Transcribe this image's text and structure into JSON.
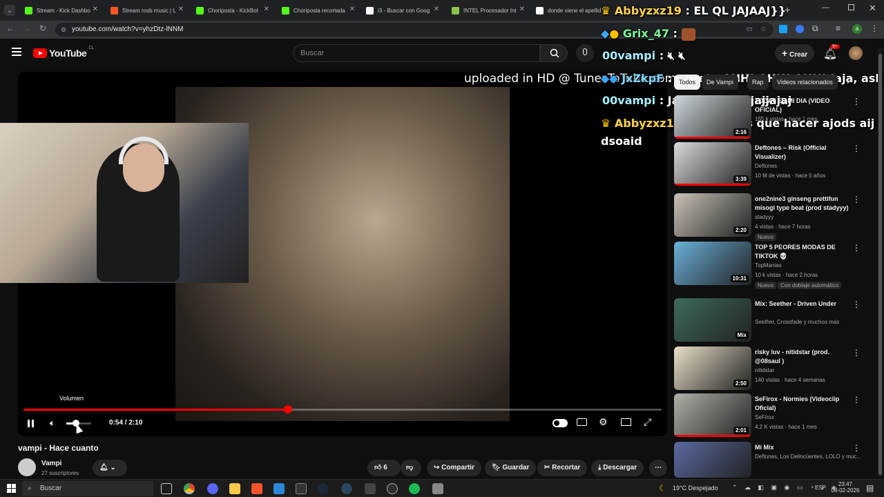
{
  "browser": {
    "tabs": [
      {
        "label": "Stream - Kick Dashbo",
        "color": "#53fc18"
      },
      {
        "label": "Stream rosb music | L",
        "color": "#ff5722"
      },
      {
        "label": "Choriposta - KickBot",
        "color": "#53fc18"
      },
      {
        "label": "Choriposta recortada",
        "color": "#53fc18"
      },
      {
        "label": "i3 - Buscar con Goog",
        "color": "#ffffff"
      },
      {
        "label": "INTEL Procesador Int",
        "color": "#8bc34a"
      },
      {
        "label": "donde viene el apellid",
        "color": "#ffffff"
      }
    ],
    "url": "youtube.com/watch?v=yhzDtz-lNNM"
  },
  "youtube": {
    "logo": "YouTube",
    "country": "CL",
    "search_placeholder": "Buscar",
    "create_label": "Crear",
    "notif_count": "9+"
  },
  "chat": [
    {
      "user": "Abbyzxz19",
      "msg": ": EL QL JAJAAJ}}"
    },
    {
      "user": "Grix_47",
      "msg": ":"
    },
    {
      "user": "00vampi",
      "msg": ":"
    },
    {
      "user": "JxZkpF",
      "msg": ": vegeta AHH! AHH! AHH! Jaja, ash"
    },
    {
      "user": "00vampi",
      "msg": ": Jajajajajajjajajajjajaj"
    },
    {
      "user": "Abbyzxz19",
      "msg": ": no sabias que hacer ajods aij"
    },
    {
      "user": "",
      "msg": "dsoaid"
    }
  ],
  "video": {
    "overlay_text": "uploaded in HD @ TunesToTube.com",
    "volume_tooltip": "Volumen",
    "time_current": "0:54",
    "time_total": "2:10",
    "progress": 0.415,
    "volume": 0.4
  },
  "watch": {
    "title": "vampi - Hace cuanto",
    "channel": "Vampi",
    "subscribers": "27 suscriptores",
    "likes": "6",
    "share": "Compartir",
    "save": "Guardar",
    "clip": "Recortar",
    "download": "Descargar"
  },
  "chips": [
    "Todos",
    "De Vampi",
    "Rap",
    "Videos relacionados"
  ],
  "recommendations": [
    {
      "title": "TODAY ES MI DIA (VIDEO OFICIAL)",
      "channel": "",
      "meta": "155 k vistas · hace 1 mes",
      "duration": "2:16",
      "badge": "",
      "progress": 1.0,
      "thumb": "#cfd8dc"
    },
    {
      "title": "Deftones – Risk (Official Visualizer)",
      "channel": "Deftones",
      "meta": "10 M de vistas · hace 5 años",
      "duration": "3:39",
      "badge": "",
      "progress": 1.0,
      "thumb": "#dadada"
    },
    {
      "title": "one2nine3 ginseng prettifun misogi type beat (prod stadyyy)",
      "channel": "stadyyy",
      "meta": "4 vistas · hace 7 horas",
      "duration": "2:20",
      "badge": "Nuevo",
      "progress": 0,
      "thumb": "#c9c2b8"
    },
    {
      "title": "TOP 5 PEORES MODAS DE TIKTOK 💀",
      "channel": "TopManias",
      "meta": "10 k vistas · hace 2 horas",
      "duration": "10:31",
      "badge": "Nuevo",
      "badge2": "Con doblaje automático",
      "progress": 0,
      "thumb": "#6ab0d8"
    },
    {
      "title": "Mix: Seether - Driven Under",
      "channel": "Seether, Crossfade y muchos más",
      "meta": "",
      "duration": "Mix",
      "badge": "",
      "progress": 0,
      "thumb": "#3d6b5b"
    },
    {
      "title": "risky luv - nitidstar (prod. @08saul )",
      "channel": "nitidstar",
      "meta": "140 vistas · hace 4 semanas",
      "duration": "2:50",
      "badge": "",
      "progress": 0,
      "thumb": "#e8e0c8"
    },
    {
      "title": "SeFirox - Normies (Videoclip Oficial)",
      "channel": "SeFirox",
      "meta": "4.2 K vistas · hace 1 mes",
      "duration": "2:01",
      "badge": "",
      "progress": 1.0,
      "thumb": "#b0b0a8"
    },
    {
      "title": "Mi Mix",
      "channel": "Deftones, Los Delincüentes, LOLO y muc...",
      "meta": "",
      "duration": "",
      "badge": "",
      "progress": 0,
      "thumb": "#5a6aa0"
    }
  ],
  "taskbar": {
    "search": "Buscar",
    "weather": "19°C Despejado",
    "lang": "ESP",
    "time": "23:47",
    "date": "08-02-2026"
  }
}
